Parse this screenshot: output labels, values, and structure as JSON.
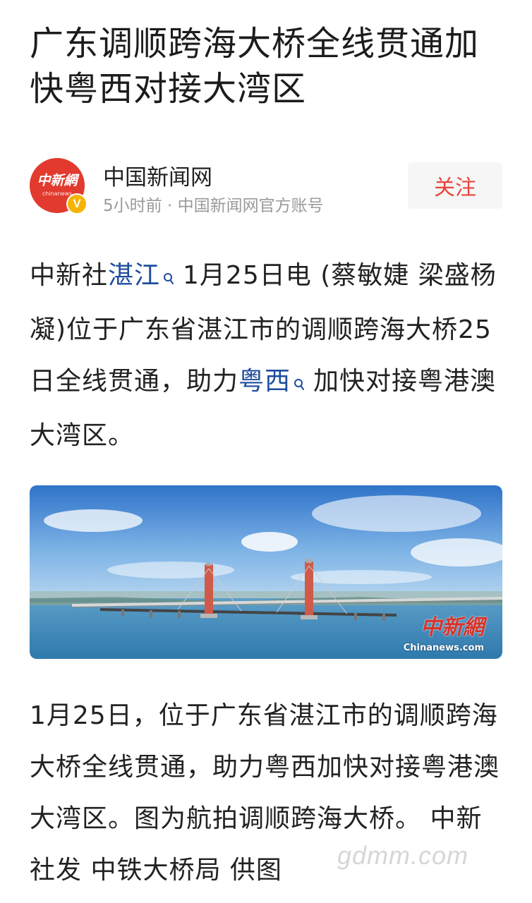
{
  "article": {
    "title": "广东调顺跨海大桥全线贯通加快粤西对接大湾区"
  },
  "author": {
    "name": "中国新闻网",
    "meta": "5小时前 · 中国新闻网官方账号",
    "avatar_text": "中新網",
    "avatar_sub": "chinanews",
    "verified_badge": "V",
    "follow_label": "关注"
  },
  "paragraph1": {
    "part1": "中新社",
    "link1": "湛江",
    "part2": "1月25日电 (蔡敏婕 梁盛杨凝)位于广东省湛江市的调顺跨海大桥25日全线贯通，助力",
    "link2": "粤西",
    "part3": "加快对接粤港澳大湾区。"
  },
  "photo": {
    "watermark_cn": "中新網",
    "watermark_en": "Chinanews.com"
  },
  "paragraph2": {
    "text": "1月25日，位于广东省湛江市的调顺跨海大桥全线贯通，助力粤西加快对接粤港澳大湾区。图为航拍调顺跨海大桥。 中新社发 中铁大桥局 供图"
  },
  "site_watermark": "gdmm.com",
  "colors": {
    "link": "#1f4d9c",
    "follow": "#e8453c",
    "avatar": "#e23a2e",
    "badge": "#f4b400"
  }
}
